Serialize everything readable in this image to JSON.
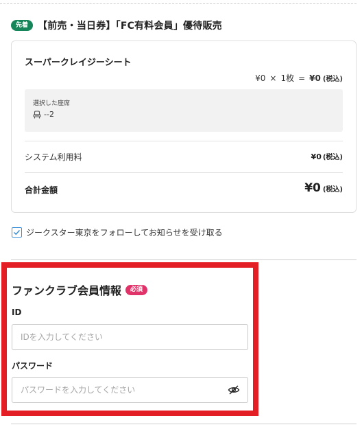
{
  "sale": {
    "badge": "先着",
    "title": "【前売・当日券】「FC有料会員」優待販売"
  },
  "ticket": {
    "seat_type": "スーパークレイジーシート",
    "unit_price": "¥0",
    "times": "×",
    "quantity": "1枚",
    "equals": "=",
    "subtotal": "¥0",
    "tax_note": "(税込)",
    "selected_seat_label": "選択した座席",
    "selected_seat_value": "--2",
    "system_fee_label": "システム利用料",
    "system_fee_value": "¥0",
    "total_label": "合計金額",
    "total_value": "¥0"
  },
  "follow": {
    "checked": true,
    "label": "ジークスター東京をフォローしてお知らせを受け取る"
  },
  "fanclub": {
    "title": "ファンクラブ会員情報",
    "required_badge": "必須",
    "id_label": "ID",
    "id_placeholder": "IDを入力してください",
    "password_label": "パスワード",
    "password_placeholder": "パスワードを入力してください"
  },
  "colors": {
    "badge_green": "#16865a",
    "required_pink": "#e0336a",
    "highlight_red": "#e31e24",
    "checkbox_blue": "#3a8ed8"
  },
  "icons": [
    "seat-icon",
    "check-icon",
    "eye-slash-icon"
  ]
}
